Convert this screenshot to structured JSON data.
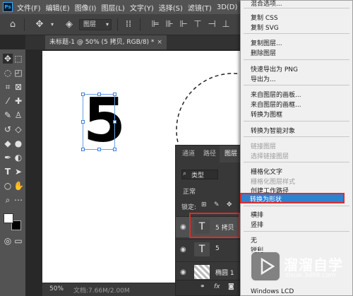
{
  "app": {
    "logo": "Ps"
  },
  "menubar": {
    "items": [
      "文件(F)",
      "编辑(E)",
      "图像(I)",
      "图层(L)",
      "文字(Y)",
      "选择(S)",
      "滤镜(T)",
      "3D(D)",
      "视"
    ]
  },
  "options_bar": {
    "layer_select": "图层"
  },
  "document": {
    "tab_title": "未标题-1 @ 50% (5 拷贝, RGB/8) *",
    "close": "×",
    "canvas_text": "5"
  },
  "status": {
    "zoom": "50%",
    "doc_size": "文档:7.66M/2.00M"
  },
  "layers_panel": {
    "tabs": [
      "通道",
      "路径",
      "图层"
    ],
    "kind_filter": "类型",
    "blend_mode": "正常",
    "lock_label": "锁定:",
    "layers": [
      {
        "thumb": "T",
        "name": "5 拷贝"
      },
      {
        "thumb": "T",
        "name": "5"
      },
      {
        "thumb": "",
        "name": "椭圆 1"
      }
    ],
    "footer_fx": "fx"
  },
  "context_menu": {
    "items": [
      {
        "label": "混合选项...",
        "disabled": false
      },
      {
        "label": "复制 CSS",
        "disabled": false
      },
      {
        "label": "复制 SVG",
        "disabled": false
      },
      {
        "label": "复制图层...",
        "disabled": false
      },
      {
        "label": "删除图层",
        "disabled": false
      },
      {
        "label": "快速导出为 PNG",
        "disabled": false
      },
      {
        "label": "导出为...",
        "disabled": false
      },
      {
        "label": "来自图层的画板...",
        "disabled": false
      },
      {
        "label": "来自图层的画框...",
        "disabled": false
      },
      {
        "label": "转换为图框",
        "disabled": false
      },
      {
        "label": "转换为智能对象",
        "disabled": false
      },
      {
        "label": "链接图层",
        "disabled": true
      },
      {
        "label": "选择链接图层",
        "disabled": true
      },
      {
        "label": "栅格化文字",
        "disabled": false
      },
      {
        "label": "栅格化图层样式",
        "disabled": true
      },
      {
        "label": "创建工作路径",
        "disabled": false
      },
      {
        "label": "转换为形状",
        "disabled": false,
        "highlighted": true
      },
      {
        "label": "横排",
        "disabled": false
      },
      {
        "label": "竖排",
        "disabled": false
      },
      {
        "label": "无",
        "disabled": false
      },
      {
        "label": "锐利",
        "disabled": false
      },
      {
        "label": "Windows LCD",
        "disabled": false
      }
    ]
  },
  "watermark": {
    "title": "溜溜自学",
    "url": "zixue.3d66.com"
  },
  "colors": {
    "highlight": "#2b83d3",
    "annotation_red": "#e02b2b",
    "menu_bg": "#f0f0f0"
  }
}
